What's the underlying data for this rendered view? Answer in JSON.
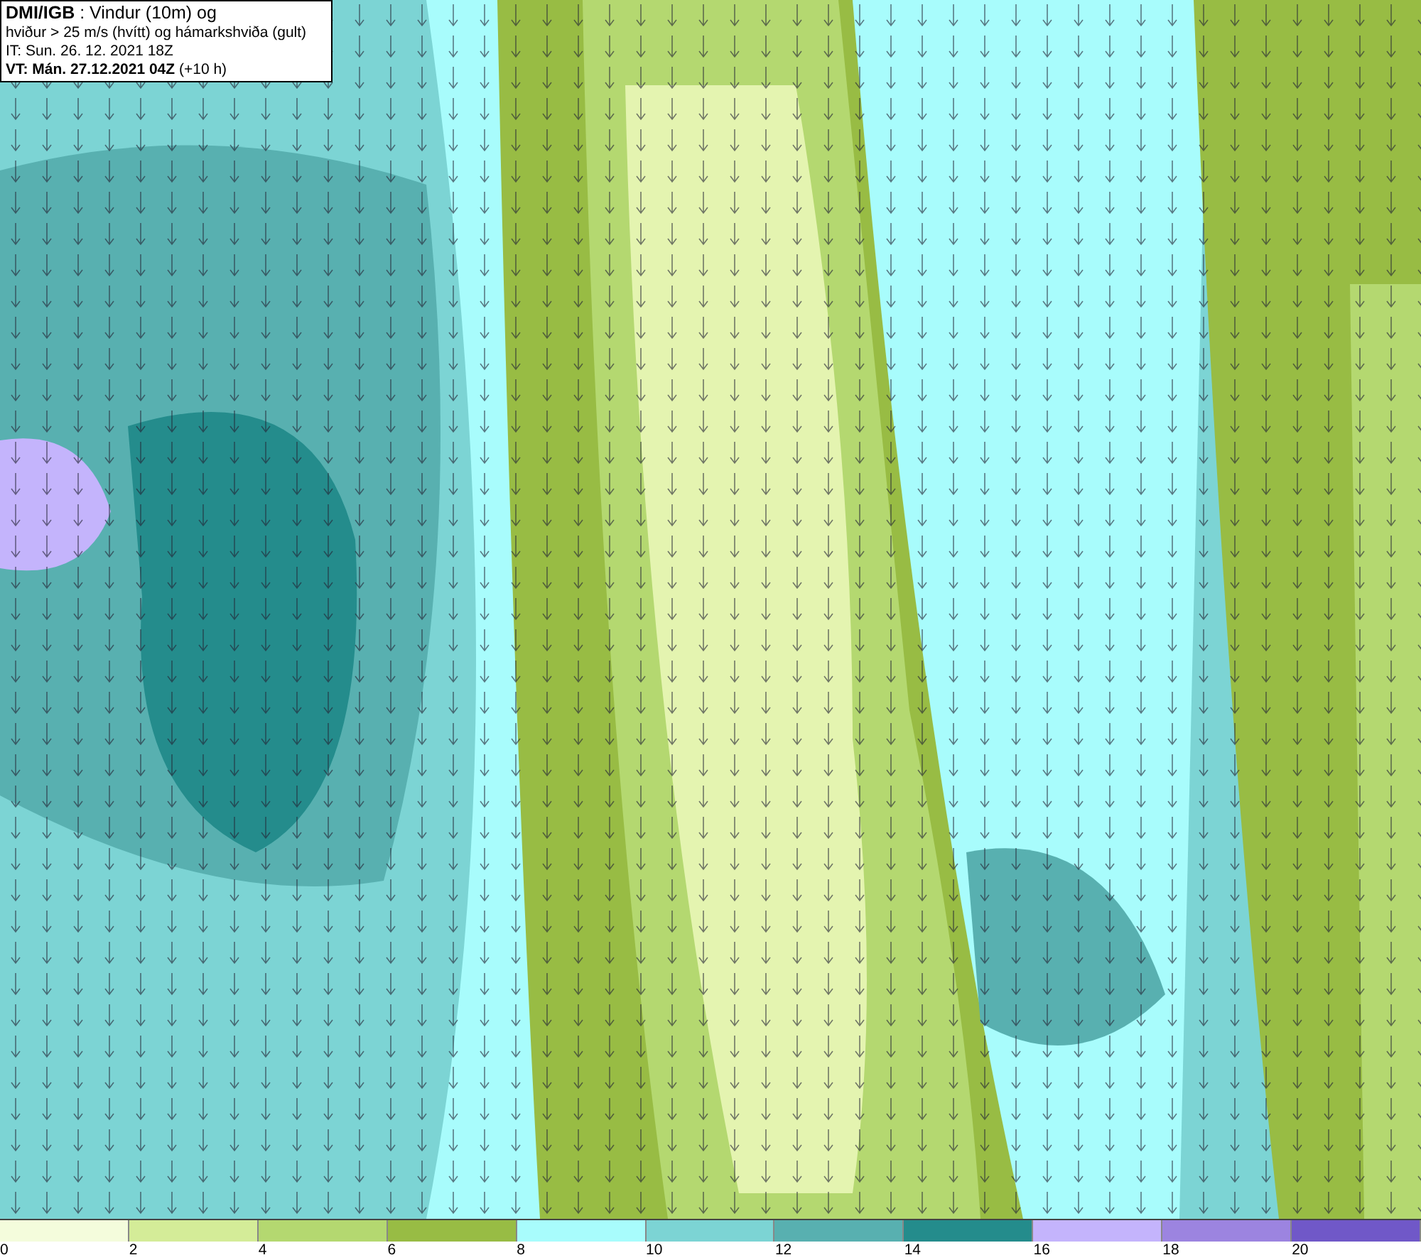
{
  "header": {
    "lines": [
      "**DMI/IGB** : Vindur (10m) og",
      "hviður > 25 m/s (hvítt) og hámarkshviða (gult)",
      "IT: Sun. 26. 12. 2021 18Z",
      "**VT: Mán. 27.12.2021 04Z** (+10 h)"
    ]
  },
  "legend": {
    "bins": [
      {
        "label": "0",
        "color": "#f4fcdc"
      },
      {
        "label": "2",
        "color": "#d4ec98"
      },
      {
        "label": "4",
        "color": "#b4d870"
      },
      {
        "label": "6",
        "color": "#98bc44"
      },
      {
        "label": "8",
        "color": "#a8fcfc"
      },
      {
        "label": "10",
        "color": "#7cd4d4"
      },
      {
        "label": "12",
        "color": "#58b0b0"
      },
      {
        "label": "14",
        "color": "#248c8c"
      },
      {
        "label": "16",
        "color": "#c4b4fc"
      },
      {
        "label": "18",
        "color": "#9c84e0"
      },
      {
        "label": "20",
        "color": "#7058c8"
      }
    ]
  }
}
